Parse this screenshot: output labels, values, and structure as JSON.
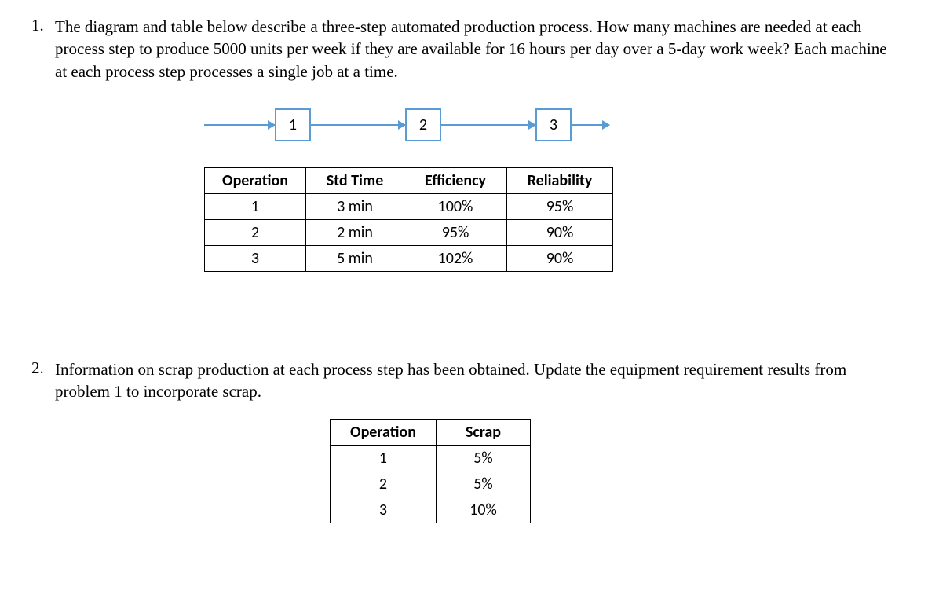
{
  "problems": [
    {
      "number": "1.",
      "text": "The diagram and table below describe a three-step automated production process. How many machines are needed at each process step to produce 5000 units per week if they are available for 16 hours per day over a 5-day work week? Each machine at each process step processes a single job at a time."
    },
    {
      "number": "2.",
      "text": "Information on scrap production at each process step has been obtained. Update the equipment requirement results from problem 1 to incorporate scrap."
    }
  ],
  "diagram": {
    "box1": "1",
    "box2": "2",
    "box3": "3"
  },
  "table1": {
    "headers": {
      "c0": "Operation",
      "c1": "Std Time",
      "c2": "Efficiency",
      "c3": "Reliability"
    },
    "rows": [
      {
        "c0": "1",
        "c1": "3 min",
        "c2": "100%",
        "c3": "95%"
      },
      {
        "c0": "2",
        "c1": "2 min",
        "c2": "95%",
        "c3": "90%"
      },
      {
        "c0": "3",
        "c1": "5 min",
        "c2": "102%",
        "c3": "90%"
      }
    ]
  },
  "table2": {
    "headers": {
      "c0": "Operation",
      "c1": "Scrap"
    },
    "rows": [
      {
        "c0": "1",
        "c1": "5%"
      },
      {
        "c0": "2",
        "c1": "5%"
      },
      {
        "c0": "3",
        "c1": "10%"
      }
    ]
  }
}
